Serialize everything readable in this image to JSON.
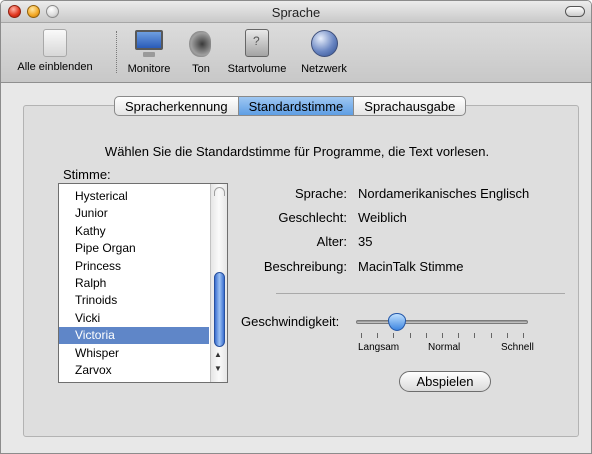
{
  "window": {
    "title": "Sprache"
  },
  "toolbar": {
    "items": [
      {
        "label": "Alle einblenden",
        "icon": "apple-prefs-icon"
      },
      {
        "label": "Monitore",
        "icon": "monitor-icon"
      },
      {
        "label": "Ton",
        "icon": "speaker-icon"
      },
      {
        "label": "Startvolume",
        "icon": "disk-icon"
      },
      {
        "label": "Netzwerk",
        "icon": "globe-icon"
      }
    ]
  },
  "tabs": [
    {
      "label": "Spracherkennung",
      "active": false
    },
    {
      "label": "Standardstimme",
      "active": true
    },
    {
      "label": "Sprachausgabe",
      "active": false
    }
  ],
  "instruction": "Wählen Sie die Standardstimme für Programme, die Text vorlesen.",
  "voice_list": {
    "label": "Stimme:",
    "items": [
      "Hysterical",
      "Junior",
      "Kathy",
      "Pipe Organ",
      "Princess",
      "Ralph",
      "Trinoids",
      "Vicki",
      "Victoria",
      "Whisper",
      "Zarvox"
    ],
    "selected": "Victoria"
  },
  "details": {
    "sprache_label": "Sprache:",
    "sprache_value": "Nordamerikanisches Englisch",
    "geschlecht_label": "Geschlecht:",
    "geschlecht_value": "Weiblich",
    "alter_label": "Alter:",
    "alter_value": "35",
    "beschreibung_label": "Beschreibung:",
    "beschreibung_value": "MacinTalk Stimme"
  },
  "speed": {
    "label": "Geschwindigkeit:",
    "min_label": "Langsam",
    "mid_label": "Normal",
    "max_label": "Schnell",
    "value_fraction": 0.22
  },
  "play_button": "Abspielen",
  "colors": {
    "selection": "#5f86c8",
    "tab_active": "#5e9ee4",
    "slider_knob": "#3e86e0"
  }
}
